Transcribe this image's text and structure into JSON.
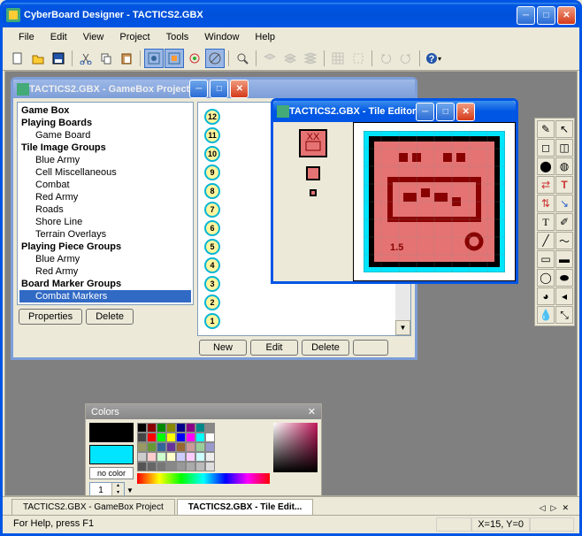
{
  "app": {
    "title": "CyberBoard Designer - TACTICS2.GBX"
  },
  "menu": [
    "File",
    "Edit",
    "View",
    "Project",
    "Tools",
    "Window",
    "Help"
  ],
  "gamebox_window": {
    "title": "TACTICS2.GBX - GameBox Project",
    "tree": [
      {
        "type": "hdr",
        "label": "Game Box"
      },
      {
        "type": "hdr",
        "label": "Playing Boards"
      },
      {
        "type": "item",
        "label": "Game Board"
      },
      {
        "type": "hdr",
        "label": "Tile Image Groups"
      },
      {
        "type": "item",
        "label": "Blue Army"
      },
      {
        "type": "item",
        "label": "Cell Miscellaneous"
      },
      {
        "type": "item",
        "label": "Combat"
      },
      {
        "type": "item",
        "label": "Red Army"
      },
      {
        "type": "item",
        "label": "Roads"
      },
      {
        "type": "item",
        "label": "Shore Line"
      },
      {
        "type": "item",
        "label": "Terrain Overlays"
      },
      {
        "type": "hdr",
        "label": "Playing Piece Groups"
      },
      {
        "type": "item",
        "label": "Blue Army"
      },
      {
        "type": "item",
        "label": "Red Army"
      },
      {
        "type": "hdr",
        "label": "Board Marker Groups"
      },
      {
        "type": "item",
        "label": "Combat Markers",
        "selected": true
      }
    ],
    "buttons": {
      "properties": "Properties",
      "delete": "Delete",
      "new": "New",
      "edit": "Edit",
      "delete2": "Delete"
    },
    "tiles": [
      1,
      2,
      3,
      4,
      5,
      6,
      7,
      8,
      9,
      10,
      11,
      12
    ]
  },
  "tile_editor": {
    "title": "TACTICS2.GBX - Tile Editor"
  },
  "colors": {
    "title": "Colors",
    "nocolor": "no color",
    "opacity": "1",
    "swatch1": "#000000",
    "swatch2": "#00e5ff",
    "palette": [
      "#000",
      "#800",
      "#080",
      "#880",
      "#008",
      "#808",
      "#088",
      "#888",
      "#444",
      "#f00",
      "#0f0",
      "#ff0",
      "#00f",
      "#f0f",
      "#0ff",
      "#fff",
      "#996",
      "#693",
      "#369",
      "#639",
      "#963",
      "#c99",
      "#9c9",
      "#99c",
      "#ccc",
      "#fcc",
      "#cfc",
      "#ffc",
      "#ccf",
      "#fcf",
      "#cff",
      "#eee",
      "#555",
      "#666",
      "#777",
      "#888",
      "#999",
      "#aaa",
      "#bbb",
      "#ddd"
    ]
  },
  "tabs": [
    {
      "label": "TACTICS2.GBX - GameBox Project",
      "active": false
    },
    {
      "label": "TACTICS2.GBX - Tile Edit...",
      "active": true
    }
  ],
  "status": {
    "help": "For Help, press F1",
    "coords": "X=15, Y=0"
  }
}
